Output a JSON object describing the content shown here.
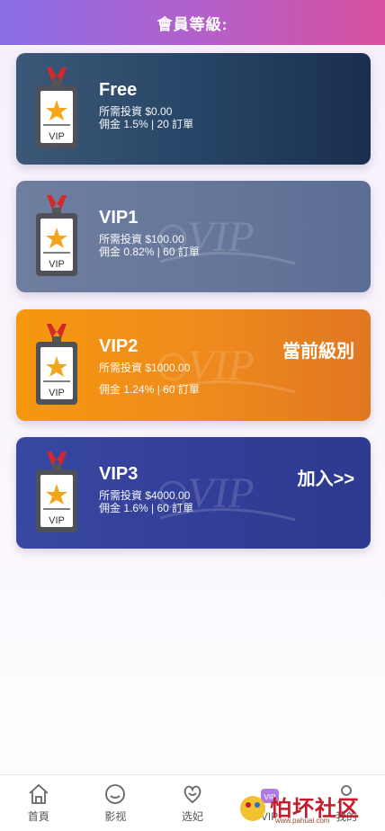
{
  "header": {
    "title": "會員等級:"
  },
  "cards": [
    {
      "name": "Free",
      "invest": "所需投資 $0.00",
      "commission": "佣金 1.5% | 20 訂單",
      "tag": "",
      "badge_text": "VIP"
    },
    {
      "name": "VIP1",
      "invest": "所需投資 $100.00",
      "commission": "佣金 0.82% | 60 訂單",
      "tag": "",
      "badge_text": "VIP"
    },
    {
      "name": "VIP2",
      "invest": "所需投資 $1000.00",
      "commission": "佣金 1.24% | 60 訂單",
      "tag": "當前級別",
      "badge_text": "VIP"
    },
    {
      "name": "VIP3",
      "invest": "所需投資 $4000.00",
      "commission": "佣金 1.6% | 60 訂單",
      "tag": "加入>>",
      "badge_text": "VIP"
    }
  ],
  "tabs": [
    {
      "label": "首頁",
      "icon": "home-icon"
    },
    {
      "label": "影视",
      "icon": "smile-icon"
    },
    {
      "label": "选妃",
      "icon": "heart-icon"
    },
    {
      "label": "VIP",
      "icon": "vip-icon"
    },
    {
      "label": "我的",
      "icon": "user-icon"
    }
  ],
  "watermark": {
    "text": "怕坏社区",
    "url": "www.pahuai.com"
  },
  "colors": {
    "header_start": "#8a6fe6",
    "header_end": "#d8509f",
    "current_card": "#f5980e",
    "vip3_card": "#3848a2"
  }
}
